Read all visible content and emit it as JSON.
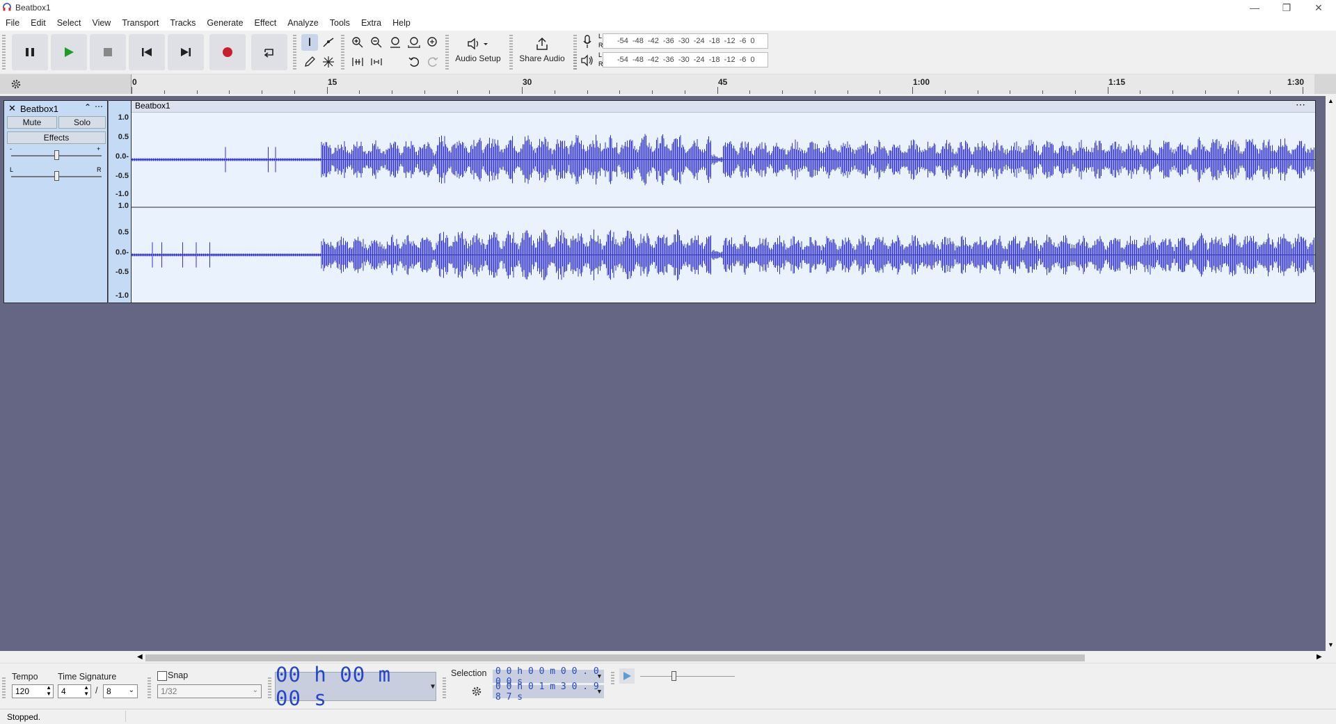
{
  "window": {
    "title": "Beatbox1"
  },
  "menu": [
    "File",
    "Edit",
    "Select",
    "View",
    "Transport",
    "Tracks",
    "Generate",
    "Effect",
    "Analyze",
    "Tools",
    "Extra",
    "Help"
  ],
  "toolbar": {
    "audio_setup_label": "Audio Setup",
    "share_audio_label": "Share Audio"
  },
  "meters": {
    "record_scale": "-54 -48 -42 -36 -30 -24 -18 -12 -6 0",
    "play_scale": "-54 -48 -42 -36 -30 -24 -18 -12 -6 0",
    "channel_l": "L",
    "channel_r": "R"
  },
  "ruler": {
    "ticks": [
      "0",
      "15",
      "30",
      "45",
      "1:00",
      "1:15",
      "1:30"
    ]
  },
  "track": {
    "name": "Beatbox1",
    "clip_name": "Beatbox1",
    "mute_label": "Mute",
    "solo_label": "Solo",
    "effects_label": "Effects",
    "gain_minus": "-",
    "gain_plus": "+",
    "pan_left": "L",
    "pan_right": "R",
    "gain_level": 0.5,
    "pan_level": 0.5,
    "amplitude_labels": [
      "1.0",
      "0.5",
      "0.0-",
      "-0.5",
      "-1.0"
    ]
  },
  "bottom": {
    "tempo_label": "Tempo",
    "tempo_value": "120",
    "timesig_label": "Time Signature",
    "timesig_num": "4",
    "timesig_sep": "/",
    "timesig_den": "8",
    "snap_label": "Snap",
    "snap_value": "1/32",
    "time_display": "00 h 00 m 00 s",
    "selection_label": "Selection",
    "selection_start": "0 0 h 0 0 m 0 0 . 0 0 0 s",
    "selection_end": "0 0 h 0 1 m 3 0 . 9 8 7 s",
    "play_speed_level": 0.35
  },
  "status": {
    "text": "Stopped."
  },
  "colors": {
    "waveform": "#3232c8",
    "track_bg": "#eaf2fd",
    "workspace": "#646684",
    "record": "#c8202a"
  }
}
